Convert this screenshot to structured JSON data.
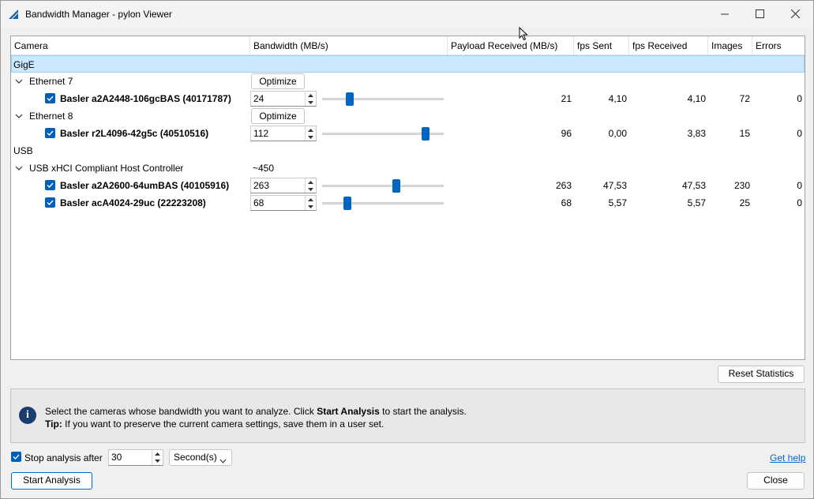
{
  "window": {
    "title": "Bandwidth Manager - pylon Viewer"
  },
  "columns": {
    "camera": "Camera",
    "bandwidth": "Bandwidth (MB/s)",
    "payload": "Payload Received (MB/s)",
    "fps_sent": "fps Sent",
    "fps_received": "fps Received",
    "images": "Images",
    "errors": "Errors"
  },
  "groups": {
    "gige": "GigE",
    "usb": "USB"
  },
  "adapters": {
    "eth7": {
      "label": "Ethernet 7",
      "action": "Optimize"
    },
    "eth8": {
      "label": "Ethernet 8",
      "action": "Optimize"
    },
    "usbhc": {
      "label": "USB xHCI Compliant Host Controller",
      "bandwidth": "~450"
    }
  },
  "cameras": [
    {
      "name": "Basler a2A2448-106gcBAS (40171787)",
      "bandwidth": "24",
      "slider_level": 0.2,
      "payload": "21",
      "fps_sent": "4,10",
      "fps_received": "4,10",
      "images": "72",
      "errors": "0",
      "checked": true
    },
    {
      "name": "Basler r2L4096-42g5c (40510516)",
      "bandwidth": "112",
      "slider_level": 0.87,
      "payload": "96",
      "fps_sent": "0,00",
      "fps_received": "3,83",
      "images": "15",
      "errors": "0",
      "checked": true
    },
    {
      "name": "Basler a2A2600-64umBAS (40105916)",
      "bandwidth": "263",
      "slider_level": 0.61,
      "payload": "263",
      "fps_sent": "47,53",
      "fps_received": "47,53",
      "images": "230",
      "errors": "0",
      "checked": true
    },
    {
      "name": "Basler acA4024-29uc (22223208)",
      "bandwidth": "68",
      "slider_level": 0.18,
      "payload": "68",
      "fps_sent": "5,57",
      "fps_received": "5,57",
      "images": "25",
      "errors": "0",
      "checked": true
    }
  ],
  "reset_button": "Reset Statistics",
  "info": {
    "line1_pre": "Select the cameras whose bandwidth you want to analyze. Click ",
    "line1_bold": "Start Analysis",
    "line1_post": " to start the analysis.",
    "tip_label": "Tip:",
    "tip_text": " If you want to preserve the current camera settings, save them in a user set."
  },
  "stop_analysis": {
    "label": "Stop analysis after",
    "checked": true,
    "value": "30",
    "unit": "Second(s)"
  },
  "help_link": "Get help",
  "start_button": "Start Analysis",
  "close_button": "Close",
  "colors": {
    "accent": "#005fb8",
    "selection": "#cce8ff",
    "link": "#0066cc"
  }
}
